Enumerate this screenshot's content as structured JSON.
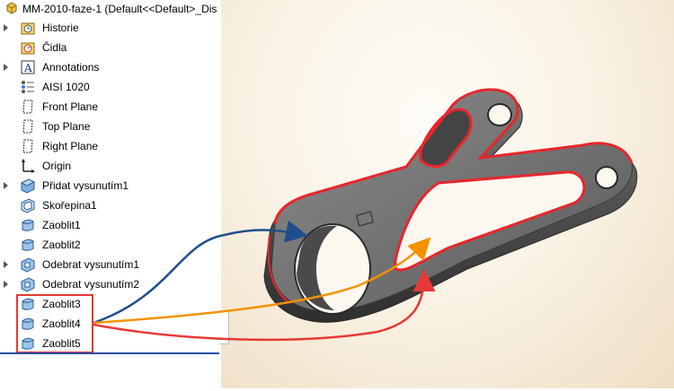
{
  "tree": {
    "title": "MM-2010-faze-1  (Default<<Default>_Dis",
    "items": [
      {
        "label": "Historie",
        "icon": "history-folder-icon",
        "expandable": true
      },
      {
        "label": "Čidla",
        "icon": "sensors-folder-icon",
        "expandable": false
      },
      {
        "label": "Annotations",
        "icon": "annotations-icon",
        "expandable": true
      },
      {
        "label": "AISI 1020",
        "icon": "material-icon",
        "expandable": false
      },
      {
        "label": "Front Plane",
        "icon": "plane-icon",
        "expandable": false
      },
      {
        "label": "Top Plane",
        "icon": "plane-icon",
        "expandable": false
      },
      {
        "label": "Right Plane",
        "icon": "plane-icon",
        "expandable": false
      },
      {
        "label": "Origin",
        "icon": "origin-icon",
        "expandable": false
      },
      {
        "label": "Přidat vysunutím1",
        "icon": "extrude-boss-icon",
        "expandable": true
      },
      {
        "label": "Skořepina1",
        "icon": "shell-icon",
        "expandable": false
      },
      {
        "label": "Zaoblit1",
        "icon": "fillet-icon",
        "expandable": false
      },
      {
        "label": "Zaoblit2",
        "icon": "fillet-icon",
        "expandable": false
      },
      {
        "label": "Odebrat vysunutím1",
        "icon": "extrude-cut-icon",
        "expandable": true
      },
      {
        "label": "Odebrat vysunutím2",
        "icon": "extrude-cut-icon",
        "expandable": true
      },
      {
        "label": "Zaoblit3",
        "icon": "fillet-icon",
        "expandable": false
      },
      {
        "label": "Zaoblit4",
        "icon": "fillet-icon",
        "expandable": false
      },
      {
        "label": "Zaoblit5",
        "icon": "fillet-icon",
        "expandable": false
      }
    ]
  },
  "colors": {
    "highlight": "#e53935",
    "arrow_blue": "#1f4e8c",
    "arrow_orange": "#f39200",
    "arrow_red": "#e53935",
    "part_body": "#5b5b5b",
    "edge_highlight": "#e8262b"
  }
}
